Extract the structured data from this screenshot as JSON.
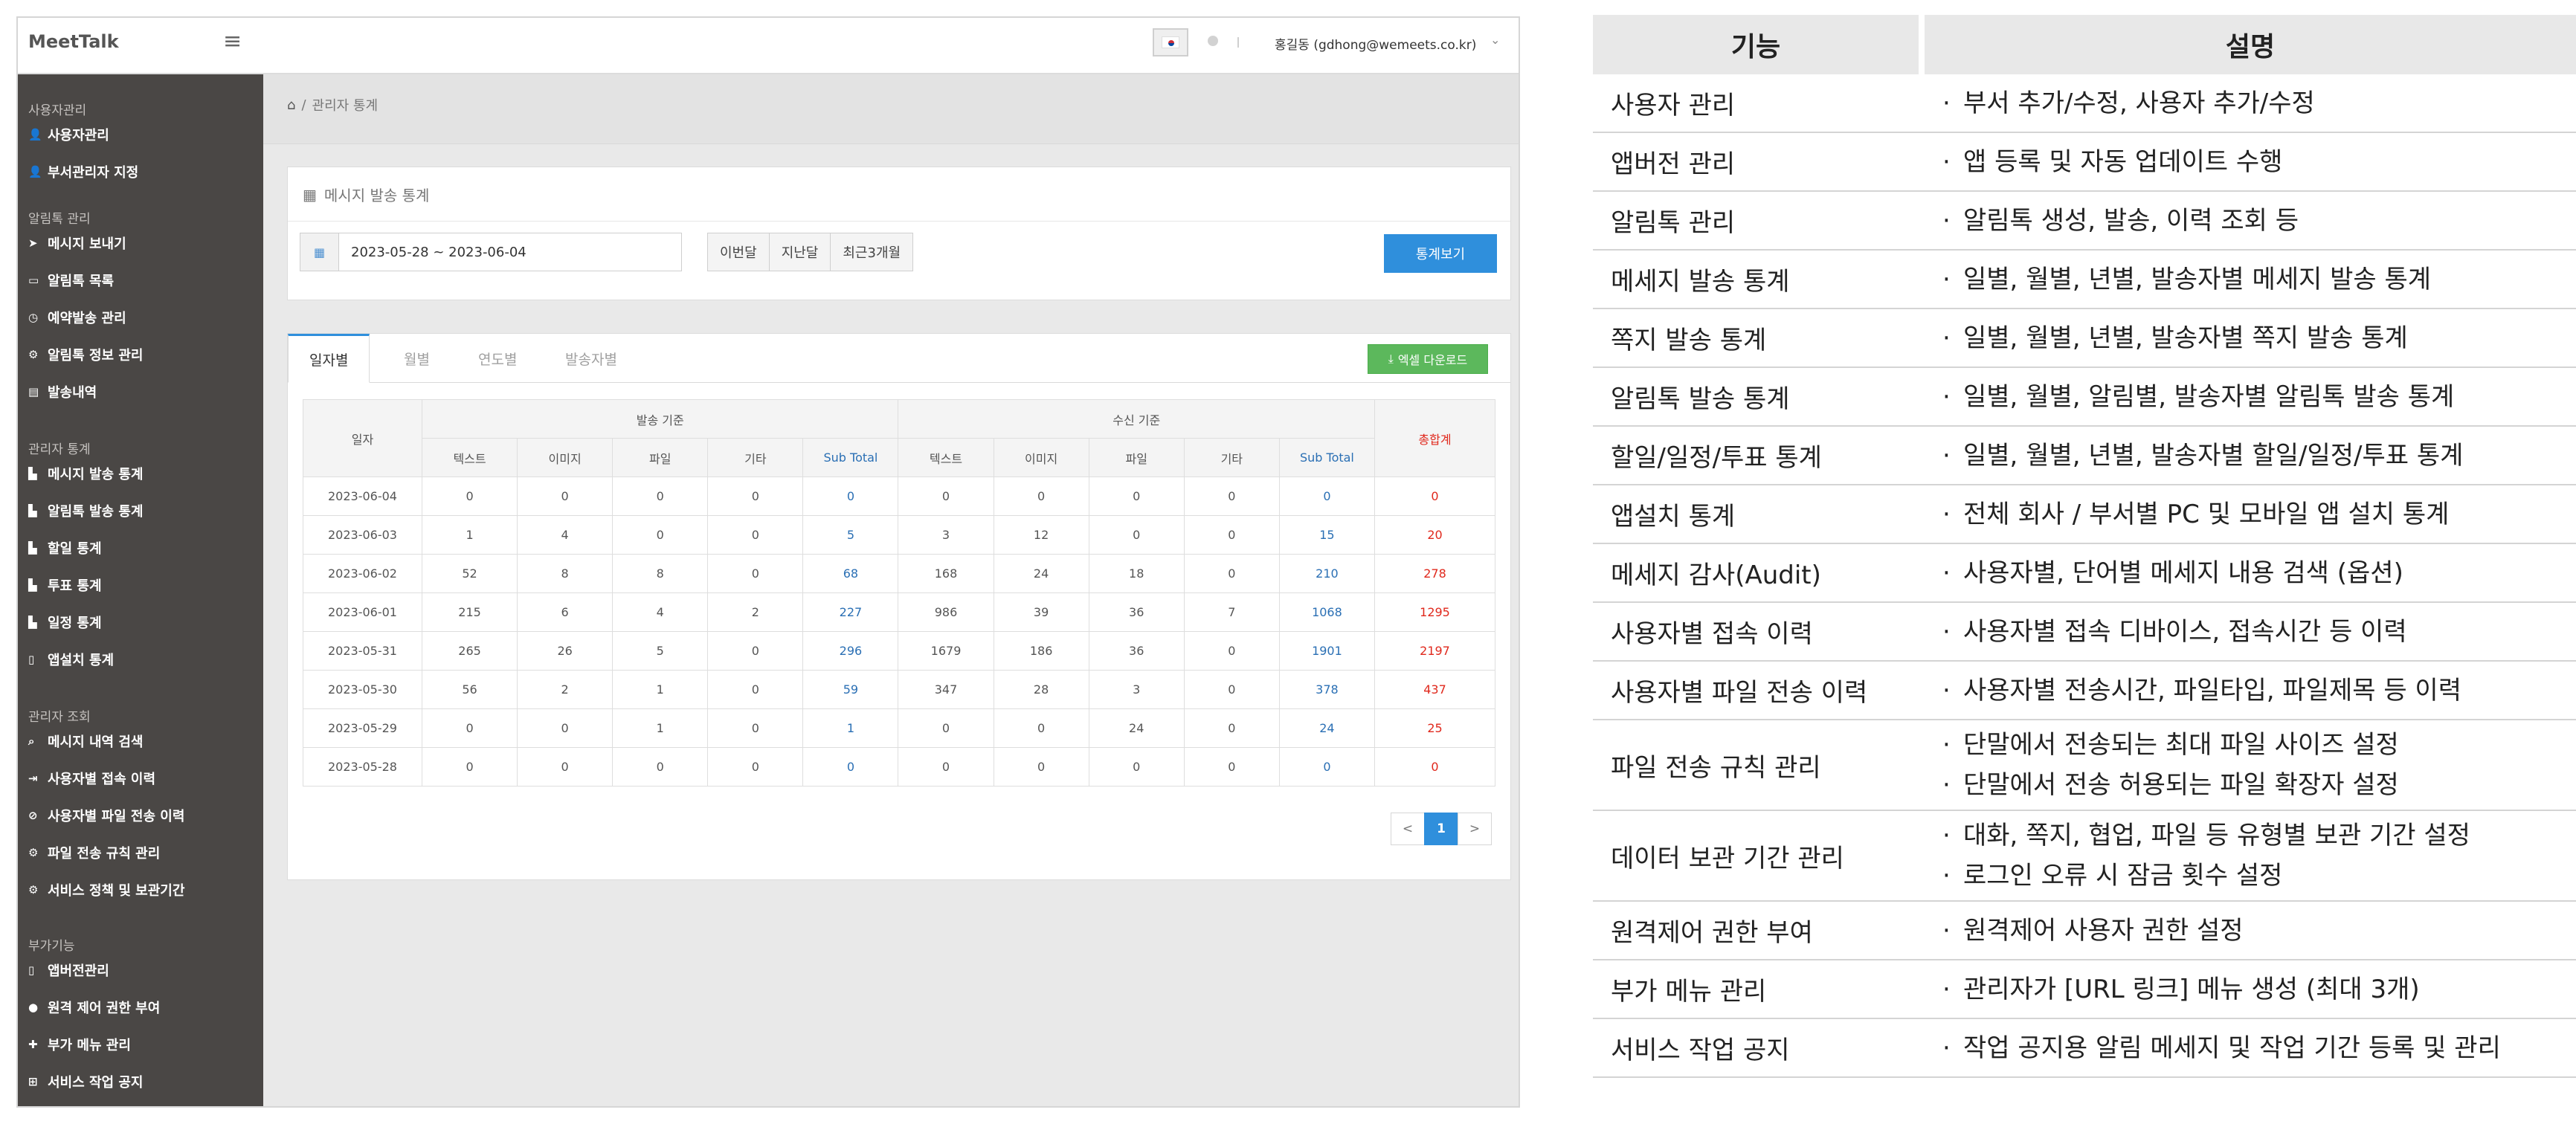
{
  "app": {
    "brand": "MeetTalk",
    "user": "홍길동 (gdhong@wemeets.co.kr)"
  },
  "sidebar": {
    "groups": [
      {
        "label": "사용자관리",
        "items": [
          {
            "label": "사용자관리",
            "icon": "user-icon"
          },
          {
            "label": "부서관리자 지정",
            "icon": "user-icon"
          }
        ]
      },
      {
        "label": "알림톡 관리",
        "items": [
          {
            "label": "메시지 보내기",
            "icon": "send-icon"
          },
          {
            "label": "알림톡 목록",
            "icon": "inbox-icon"
          },
          {
            "label": "예약발송 관리",
            "icon": "clock-icon"
          },
          {
            "label": "알림톡 정보 관리",
            "icon": "gears-icon"
          },
          {
            "label": "발송내역",
            "icon": "document-icon"
          }
        ]
      },
      {
        "label": "관리자 통계",
        "items": [
          {
            "label": "메시지 발송 통계",
            "icon": "chart-icon"
          },
          {
            "label": "알림톡 발송 통계",
            "icon": "chart-icon"
          },
          {
            "label": "할일 통계",
            "icon": "chart-icon"
          },
          {
            "label": "투표 통계",
            "icon": "chart-icon"
          },
          {
            "label": "일정 통계",
            "icon": "chart-icon"
          },
          {
            "label": "앱설치 통계",
            "icon": "mobile-icon"
          }
        ]
      },
      {
        "label": "관리자 조회",
        "items": [
          {
            "label": "메시지 내역 검색",
            "icon": "search-icon"
          },
          {
            "label": "사용자별 접속 이력",
            "icon": "login-icon"
          },
          {
            "label": "사용자별 파일 전송 이력",
            "icon": "paperclip-icon"
          },
          {
            "label": "파일 전송 규칙 관리",
            "icon": "gears-icon"
          },
          {
            "label": "서비스 정책 및 보관기간",
            "icon": "gears-icon"
          }
        ]
      },
      {
        "label": "부가기능",
        "items": [
          {
            "label": "앱버전관리",
            "icon": "mobile-icon"
          },
          {
            "label": "원격 제어 권한 부여",
            "icon": "comment-icon"
          },
          {
            "label": "부가 메뉴 관리",
            "icon": "plus-icon"
          },
          {
            "label": "서비스 작업 공지",
            "icon": "sitemap-icon"
          }
        ]
      }
    ]
  },
  "breadcrumb": {
    "current": "관리자 통계"
  },
  "filter": {
    "title": "메시지 발송 통계",
    "date_range": "2023-05-28 ~ 2023-06-04",
    "quick": [
      "이번달",
      "지난달",
      "최근3개월"
    ],
    "submit": "통계보기"
  },
  "tabs": [
    "일자별",
    "월별",
    "연도별",
    "발송자별"
  ],
  "excel_label": "엑셀 다운로드",
  "table": {
    "date_header": "일자",
    "send_header": "발송 기준",
    "recv_header": "수신 기준",
    "total_header": "총합계",
    "sub_headers": [
      "텍스트",
      "이미지",
      "파일",
      "기타",
      "Sub Total"
    ],
    "rows": [
      {
        "date": "2023-06-04",
        "send": [
          "0",
          "0",
          "0",
          "0",
          "0"
        ],
        "recv": [
          "0",
          "0",
          "0",
          "0",
          "0"
        ],
        "total": "0"
      },
      {
        "date": "2023-06-03",
        "send": [
          "1",
          "4",
          "0",
          "0",
          "5"
        ],
        "recv": [
          "3",
          "12",
          "0",
          "0",
          "15"
        ],
        "total": "20"
      },
      {
        "date": "2023-06-02",
        "send": [
          "52",
          "8",
          "8",
          "0",
          "68"
        ],
        "recv": [
          "168",
          "24",
          "18",
          "0",
          "210"
        ],
        "total": "278"
      },
      {
        "date": "2023-06-01",
        "send": [
          "215",
          "6",
          "4",
          "2",
          "227"
        ],
        "recv": [
          "986",
          "39",
          "36",
          "7",
          "1068"
        ],
        "total": "1295"
      },
      {
        "date": "2023-05-31",
        "send": [
          "265",
          "26",
          "5",
          "0",
          "296"
        ],
        "recv": [
          "1679",
          "186",
          "36",
          "0",
          "1901"
        ],
        "total": "2197"
      },
      {
        "date": "2023-05-30",
        "send": [
          "56",
          "2",
          "1",
          "0",
          "59"
        ],
        "recv": [
          "347",
          "28",
          "3",
          "0",
          "378"
        ],
        "total": "437"
      },
      {
        "date": "2023-05-29",
        "send": [
          "0",
          "0",
          "1",
          "0",
          "1"
        ],
        "recv": [
          "0",
          "0",
          "24",
          "0",
          "24"
        ],
        "total": "25"
      },
      {
        "date": "2023-05-28",
        "send": [
          "0",
          "0",
          "0",
          "0",
          "0"
        ],
        "recv": [
          "0",
          "0",
          "0",
          "0",
          "0"
        ],
        "total": "0"
      }
    ]
  },
  "pager": {
    "prev": "<",
    "current": "1",
    "next": ">"
  },
  "features": {
    "headers": [
      "기능",
      "설명"
    ],
    "rows": [
      {
        "name": "사용자 관리",
        "desc": [
          "부서 추가/수정, 사용자 추가/수정"
        ]
      },
      {
        "name": "앱버전 관리",
        "desc": [
          "앱 등록 및 자동 업데이트 수행"
        ]
      },
      {
        "name": "알림톡 관리",
        "desc": [
          "알림톡 생성, 발송, 이력 조회 등"
        ]
      },
      {
        "name": "메세지 발송 통계",
        "desc": [
          "일별, 월별, 년별, 발송자별 메세지 발송 통계"
        ]
      },
      {
        "name": "쪽지 발송 통계",
        "desc": [
          "일별, 월별, 년별, 발송자별 쪽지 발송 통계"
        ]
      },
      {
        "name": "알림톡 발송 통계",
        "desc": [
          "일별, 월별, 알림별, 발송자별 알림톡 발송 통계"
        ]
      },
      {
        "name": "할일/일정/투표 통계",
        "desc": [
          "일별, 월별, 년별, 발송자별 할일/일정/투표 통계"
        ]
      },
      {
        "name": "앱설치 통계",
        "desc": [
          "전체 회사 / 부서별 PC 및 모바일 앱 설치 통계"
        ]
      },
      {
        "name": "메세지 감사(Audit)",
        "desc": [
          "사용자별, 단어별 메세지 내용 검색 (옵션)"
        ]
      },
      {
        "name": "사용자별 접속 이력",
        "desc": [
          "사용자별 접속 디바이스, 접속시간 등 이력"
        ]
      },
      {
        "name": "사용자별 파일 전송 이력",
        "desc": [
          "사용자별 전송시간, 파일타입, 파일제목 등 이력"
        ]
      },
      {
        "name": "파일 전송 규칙 관리",
        "desc": [
          "단말에서 전송되는 최대 파일 사이즈 설정",
          "단말에서 전송 허용되는 파일 확장자 설정"
        ]
      },
      {
        "name": "데이터 보관 기간 관리",
        "desc": [
          "대화, 쪽지, 협업, 파일 등 유형별 보관 기간 설정",
          "로그인 오류 시 잠금 횟수 설정"
        ]
      },
      {
        "name": "원격제어 권한 부여",
        "desc": [
          "원격제어 사용자 권한 설정"
        ]
      },
      {
        "name": "부가 메뉴 관리",
        "desc": [
          "관리자가 [URL 링크] 메뉴 생성 (최대 3개)"
        ]
      },
      {
        "name": "서비스 작업 공지",
        "desc": [
          "작업 공지용 알림 메세지 및 작업 기간 등록 및 관리"
        ]
      }
    ]
  },
  "colors": {
    "sidebar_bg": "#4a4745",
    "accent": "#2f8fdc",
    "excel": "#5cb85c",
    "total_red": "#e0281c",
    "subtotal_blue": "#2a6fb4"
  }
}
